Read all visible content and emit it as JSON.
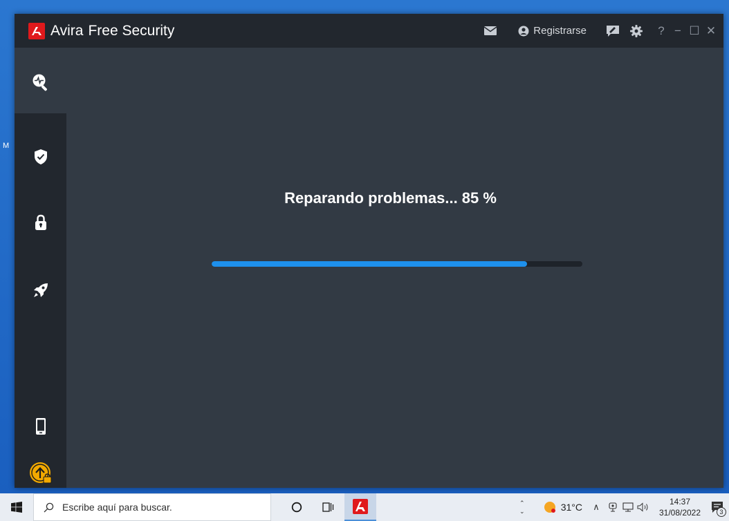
{
  "desktop": {
    "edge_letter": "M"
  },
  "window": {
    "brand_name": "Avira",
    "product_name": "Free Security",
    "register_label": "Registrarse",
    "controls": {
      "help": "?",
      "minimize": "−",
      "maximize": "☐",
      "close": "✕"
    }
  },
  "sidebar": {
    "items": [
      {
        "icon": "scan-icon",
        "active": true
      },
      {
        "icon": "shield-icon"
      },
      {
        "icon": "lock-icon"
      },
      {
        "icon": "rocket-icon"
      },
      {
        "icon": "phone-icon"
      },
      {
        "icon": "upgrade-icon"
      }
    ]
  },
  "main": {
    "status_text": "Reparando problemas... 85 %",
    "progress": 0.85
  },
  "taskbar": {
    "search_placeholder": "Escribe aquí para buscar.",
    "temperature": "31°C",
    "time": "14:37",
    "date": "31/08/2022",
    "notification_count": "3"
  },
  "colors": {
    "accent": "#1e90ec",
    "brand_red": "#e0191c",
    "window_bg": "#323a44",
    "sidebar_bg": "#22272e"
  }
}
